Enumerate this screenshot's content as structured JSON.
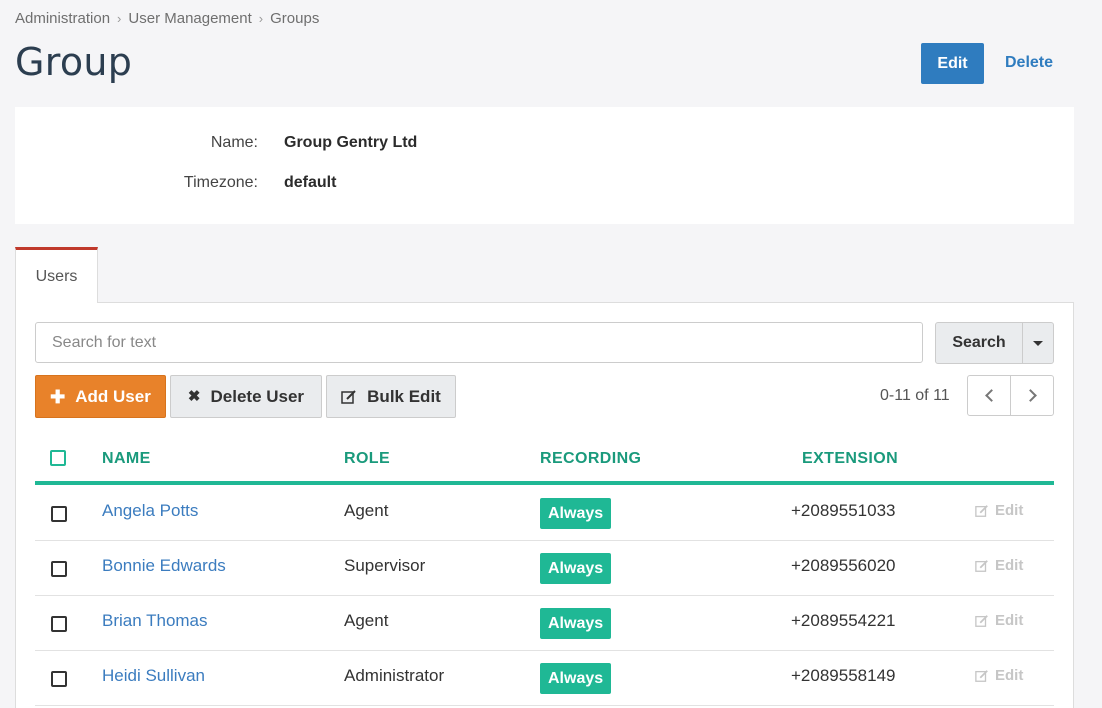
{
  "breadcrumb": [
    "Administration",
    "User Management",
    "Groups"
  ],
  "page_title": "Group",
  "header_actions": {
    "edit": "Edit",
    "delete": "Delete"
  },
  "details": {
    "name_label": "Name:",
    "name_value": "Group Gentry Ltd",
    "timezone_label": "Timezone:",
    "timezone_value": "default"
  },
  "tabs": [
    {
      "label": "Users",
      "active": true
    }
  ],
  "search": {
    "placeholder": "Search for text",
    "button": "Search"
  },
  "toolbar": {
    "add_user": "Add User",
    "delete_user": "Delete User",
    "bulk_edit": "Bulk Edit"
  },
  "pagination": {
    "text": "0-11 of 11"
  },
  "table": {
    "columns": [
      "NAME",
      "ROLE",
      "RECORDING",
      "EXTENSION"
    ],
    "rows": [
      {
        "name": "Angela Potts",
        "role": "Agent",
        "recording": "Always",
        "extension": "+2089551033",
        "action": "Edit"
      },
      {
        "name": "Bonnie Edwards",
        "role": "Supervisor",
        "recording": "Always",
        "extension": "+2089556020",
        "action": "Edit"
      },
      {
        "name": "Brian Thomas",
        "role": "Agent",
        "recording": "Always",
        "extension": "+2089554221",
        "action": "Edit"
      },
      {
        "name": "Heidi Sullivan",
        "role": "Administrator",
        "recording": "Always",
        "extension": "+2089558149",
        "action": "Edit"
      }
    ]
  },
  "colors": {
    "primary": "#2f7cbf",
    "accent": "#1fb895",
    "orange": "#e8822a",
    "tab_accent": "#c0392b"
  }
}
